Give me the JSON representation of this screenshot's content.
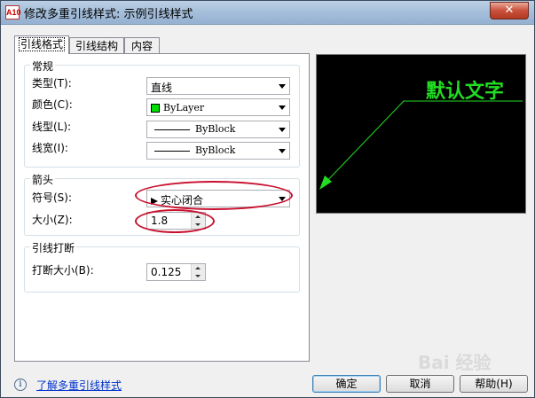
{
  "window": {
    "title": "修改多重引线样式: 示例引线样式",
    "app_icon": "A10",
    "close_label": "✕"
  },
  "tabs": [
    {
      "label": "引线格式"
    },
    {
      "label": "引线结构"
    },
    {
      "label": "内容"
    }
  ],
  "general": {
    "title": "常规",
    "type_label": "类型(T):",
    "type_value": "直线",
    "color_label": "颜色(C):",
    "color_value": "ByLayer",
    "linetype_label": "线型(L):",
    "linetype_value": "ByBlock",
    "lineweight_label": "线宽(I):",
    "lineweight_value": "ByBlock"
  },
  "arrowhead": {
    "title": "箭头",
    "symbol_label": "符号(S):",
    "symbol_value": "实心闭合",
    "size_label": "大小(Z):",
    "size_value": "1.8"
  },
  "leader_break": {
    "title": "引线打断",
    "break_size_label": "打断大小(B):",
    "break_size_value": "0.125"
  },
  "preview": {
    "text": "默认文字",
    "line_color": "#22dd22"
  },
  "footer": {
    "help_link": "了解多重引线样式",
    "ok_label": "确定",
    "cancel_label": "取消",
    "help_label": "帮助(H)"
  },
  "watermark": "Bai 经验"
}
